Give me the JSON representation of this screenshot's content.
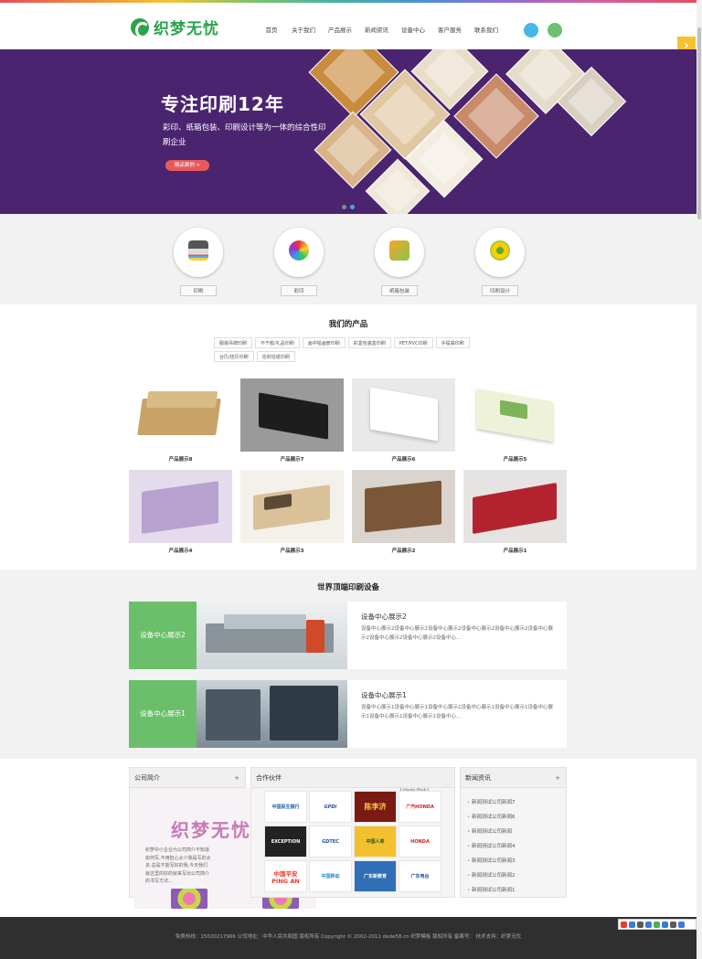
{
  "header": {
    "logo_text": "织梦无忧",
    "nav": [
      "首页",
      "关于我们",
      "产品展示",
      "新闻资讯",
      "设备中心",
      "客户服务",
      "联系我们"
    ]
  },
  "banner": {
    "title": "专注印刷12年",
    "subtitle": "彩印、纸箱包装、印刷设计等为一体的综合性印刷企业",
    "button": "精品案例 >"
  },
  "services": [
    "印刷",
    "彩印",
    "纸箱包装",
    "印刷设计"
  ],
  "products": {
    "title": "我们的产品",
    "categories": [
      "服装吊牌印刷",
      "不干胶/礼品印刷",
      "画中铅画册印刷",
      "彩盒包装盒印刷",
      "PET/PVC印刷",
      "手提袋印刷",
      "台历/挂历印刷",
      "信封信纸印刷"
    ],
    "items": [
      "产品展示8",
      "产品展示7",
      "产品展示6",
      "产品展示5",
      "产品展示4",
      "产品展示3",
      "产品展示2",
      "产品展示1"
    ]
  },
  "equipment": {
    "title": "世界顶端印刷设备",
    "items": [
      {
        "tag": "设备中心展示2",
        "title": "设备中心展示2",
        "desc": "设备中心展示2设备中心展示2设备中心展示2设备中心展示2设备中心展示2设备中心展示2设备中心展示2设备中心展示2设备中心..."
      },
      {
        "tag": "设备中心展示1",
        "title": "设备中心展示1",
        "desc": "设备中心展示1设备中心展示1设备中心展示1设备中心展示1设备中心展示1设备中心展示1设备中心展示1设备中心展示1设备中心..."
      }
    ]
  },
  "about": {
    "title": "公司简介",
    "brand": "织梦无忧",
    "text": "织梦中小企业为公司简介不知道如何写,不用担心太少我是写的太多,总是不能写好的我,今天我们就这里的好的就来写出公司简介的书写方法..."
  },
  "partners": {
    "title": "合作伙伴",
    "tag": "{/dede:flink}",
    "logos": [
      "中国民生银行",
      "GPDI",
      "陈李济",
      "广汽HONDA",
      "EXCEPTION",
      "GDTEC",
      "中国人寿",
      "HONDA",
      "中国平安 PING AN",
      "中国移动",
      "广东新教育",
      "广东电台"
    ]
  },
  "news": {
    "title": "新闻资讯",
    "items": [
      "新闻测试公司新闻7",
      "新闻测试公司新闻6",
      "新闻测试公司新闻",
      "新闻测试公司新闻4",
      "新闻测试公司新闻3",
      "新闻测试公司新闻2",
      "新闻测试公司新闻1"
    ]
  },
  "footer": {
    "text": "免费热线：15020217966  公司地址：中华人民共和国 版权所有  Copyright © 2002-2011 dede58.cn 织梦模板 版权所有 备案号：  技术支持：织梦无忧"
  },
  "colors": {
    "brand": "#2aa44a",
    "banner_bg": "#4b2470",
    "accent": "#6bbf6b",
    "footer_bg": "#2f2f2f"
  }
}
